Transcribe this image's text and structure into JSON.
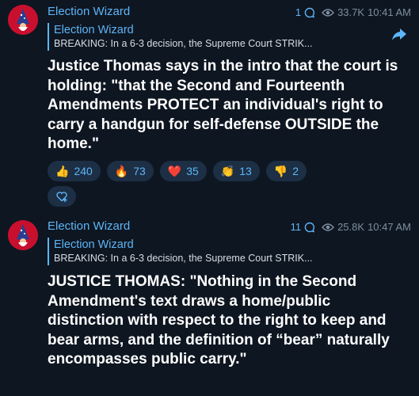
{
  "posts": [
    {
      "channel": "Election Wizard",
      "comments": "1",
      "views": "33.7K",
      "time": "10:41 AM",
      "reply_title": "Election Wizard",
      "reply_text": "BREAKING: In a 6-3 decision, the Supreme Court STRIK...",
      "body": "Justice Thomas says in the intro that the court is holding: \"that the Second and Fourteenth Amendments PROTECT an individual's right to carry a handgun for self-defense OUTSIDE the home.\"",
      "reactions": [
        {
          "emoji": "👍",
          "icon": "thumbs-up-icon",
          "count": "240"
        },
        {
          "emoji": "🔥",
          "icon": "fire-icon",
          "count": "73"
        },
        {
          "emoji": "❤️",
          "icon": "heart-icon",
          "count": "35"
        },
        {
          "emoji": "👏",
          "icon": "clap-icon",
          "count": "13"
        },
        {
          "emoji": "👎",
          "icon": "thumbs-down-icon",
          "count": "2"
        }
      ]
    },
    {
      "channel": "Election Wizard",
      "comments": "11",
      "views": "25.8K",
      "time": "10:47 AM",
      "reply_title": "Election Wizard",
      "reply_text": "BREAKING: In a 6-3 decision, the Supreme Court STRIK...",
      "body": "JUSTICE THOMAS: \"Nothing in the Second Amendment's text draws a home/public distinction with respect to the right to keep and bear arms, and the definition of “bear” naturally encompasses public carry.\""
    }
  ],
  "colors": {
    "background": "#0e1621",
    "accent": "#5eb5f7",
    "pill": "#1c2f45",
    "muted": "#7d8e9f",
    "avatar": "#c8102e"
  }
}
